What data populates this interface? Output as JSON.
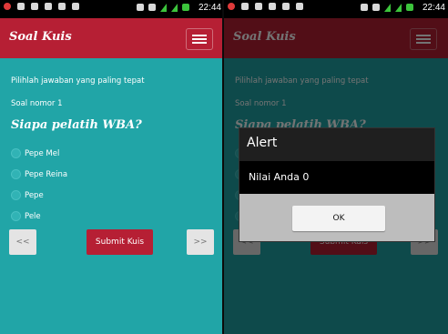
{
  "status_bar": {
    "time": "22:44"
  },
  "app": {
    "title": "Soal Kuis"
  },
  "quiz": {
    "instruction": "Pilihlah jawaban yang paling tepat",
    "question_number": "Soal nomor 1",
    "question": "Siapa pelatih WBA?",
    "options": [
      "Pepe Mel",
      "Pepe Reina",
      "Pepe",
      "Pele"
    ],
    "prev_label": "<<",
    "next_label": ">>",
    "submit_label": "Submit Kuis"
  },
  "dialog": {
    "title": "Alert",
    "message": "Nilai Anda 0",
    "ok_label": "OK"
  },
  "colors": {
    "appbar": "#b61f34",
    "content_bg": "#21a5a7",
    "dialog_bg": "#1f1f1f"
  }
}
